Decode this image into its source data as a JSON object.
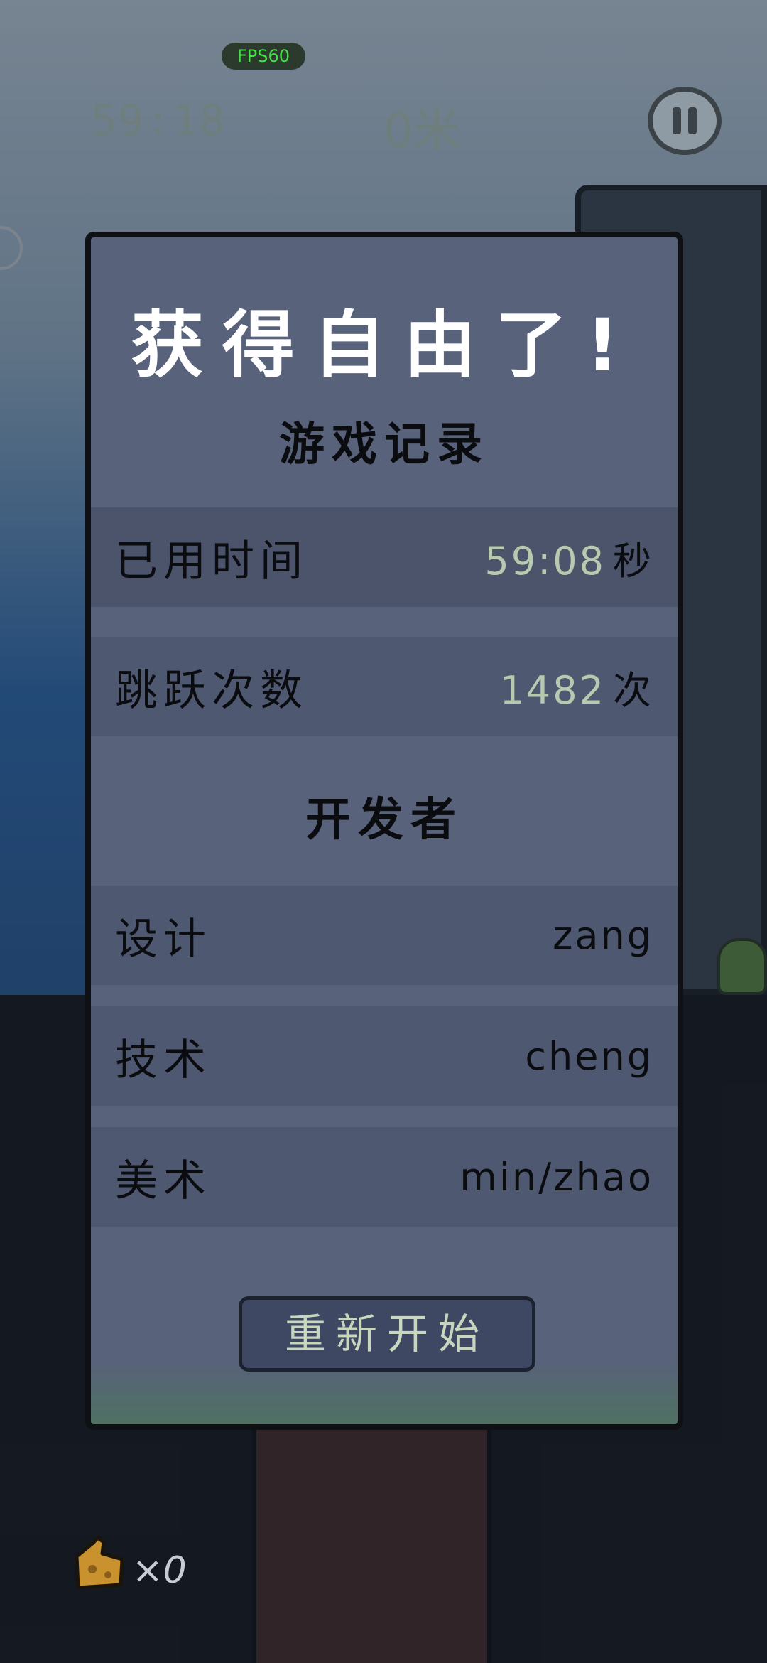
{
  "hud": {
    "fps": "FPS60",
    "time": "59:18",
    "distance": "0米"
  },
  "modal": {
    "title": "获得自由了!",
    "record_section": "游戏记录",
    "rows_record": [
      {
        "label": "已用时间",
        "value": "59:08",
        "unit": "秒"
      },
      {
        "label": "跳跃次数",
        "value": "1482",
        "unit": "次"
      }
    ],
    "developers_section": "开发者",
    "rows_dev": [
      {
        "label": "设计",
        "value": "zang"
      },
      {
        "label": "技术",
        "value": "cheng"
      },
      {
        "label": "美术",
        "value": "min/zhao"
      }
    ],
    "restart_label": "重新开始"
  },
  "footer": {
    "cheese_count": "×0"
  },
  "colors": {
    "modal_bg": "#58627a",
    "row_bg": "#4e5870",
    "number_accent": "#b7c9ae",
    "restart_bg": "#3e4863"
  }
}
